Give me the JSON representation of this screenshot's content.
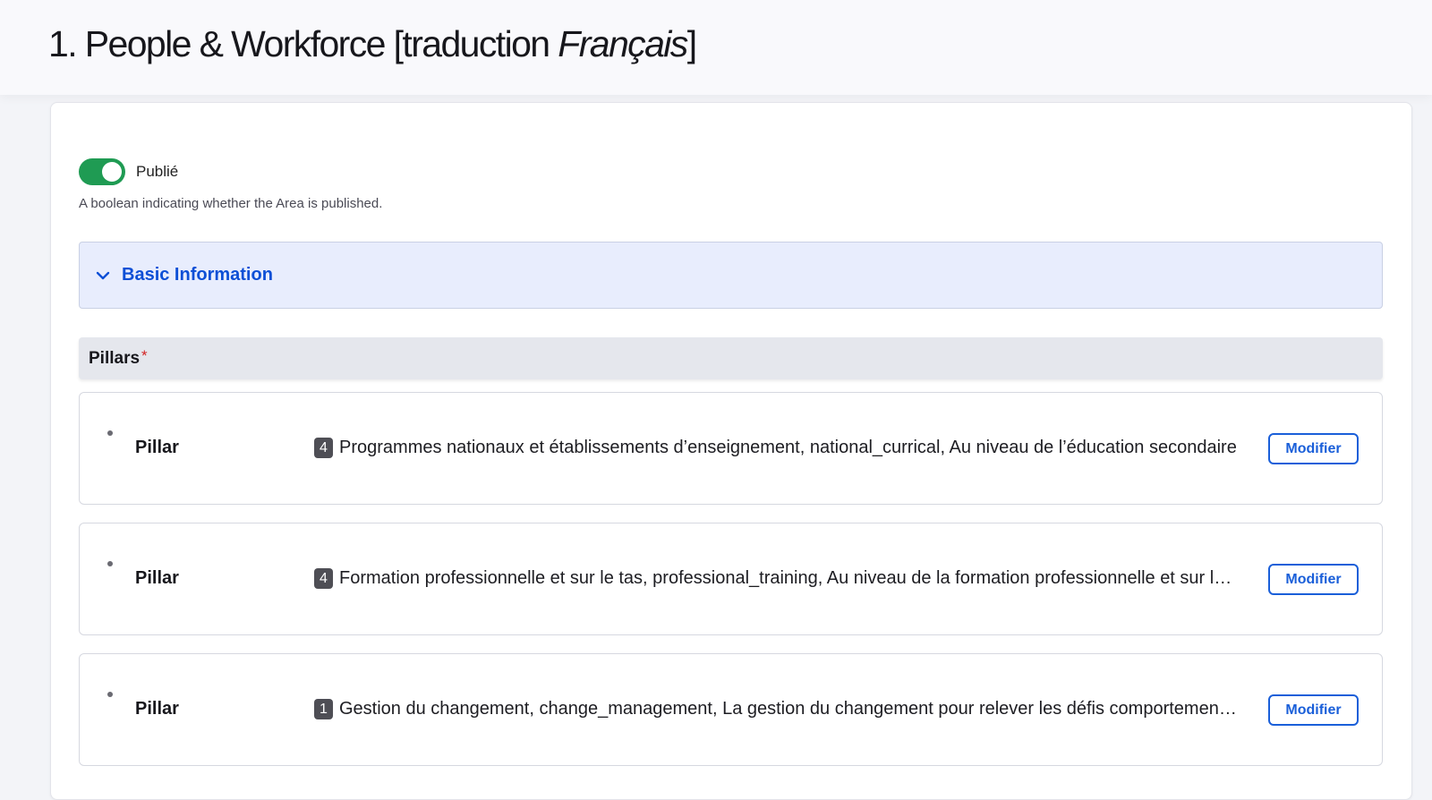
{
  "page": {
    "title_main": "1. People & Workforce [traduction ",
    "title_lang": "Français",
    "title_end": "]"
  },
  "published": {
    "label": "Publié",
    "description": "A boolean indicating whether the Area is published.",
    "enabled": true,
    "color": "#1f9b53"
  },
  "basic_info": {
    "title": "Basic Information",
    "expanded": true
  },
  "pillars": {
    "title": "Pillars",
    "required_mark": "*",
    "items": [
      {
        "label": "Pillar",
        "badge": "4",
        "text": "Programmes nationaux et établissements d’enseignement, national_currical, Au niveau de l’éducation secondaire",
        "button": "Modifier"
      },
      {
        "label": "Pillar",
        "badge": "4",
        "text": "Formation professionnelle et sur le tas, professional_training, Au niveau de la formation professionnelle et sur le tas",
        "button": "Modifier"
      },
      {
        "label": "Pillar",
        "badge": "1",
        "text": "Gestion du changement, change_management, La gestion du changement pour relever les défis comportementaux",
        "button": "Modifier"
      }
    ]
  },
  "colors": {
    "accent": "#1a5fd9",
    "accordion_bg": "#e8edfd",
    "badge_bg": "#4e4e55",
    "required": "#d32424"
  }
}
